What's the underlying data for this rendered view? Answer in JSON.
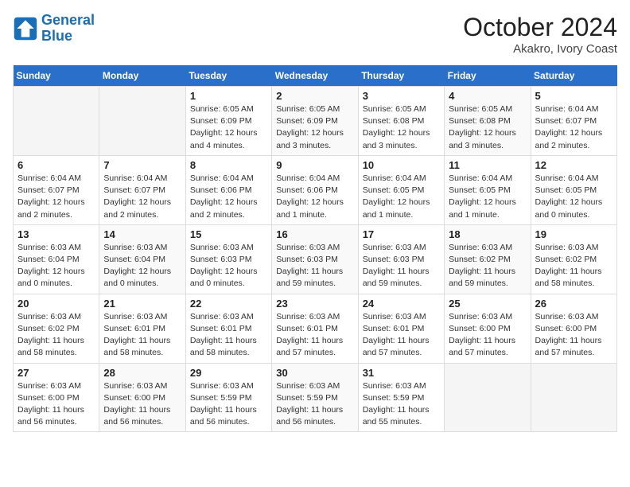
{
  "logo": {
    "line1": "General",
    "line2": "Blue"
  },
  "title": "October 2024",
  "subtitle": "Akakro, Ivory Coast",
  "days_of_week": [
    "Sunday",
    "Monday",
    "Tuesday",
    "Wednesday",
    "Thursday",
    "Friday",
    "Saturday"
  ],
  "weeks": [
    [
      {
        "num": "",
        "info": ""
      },
      {
        "num": "",
        "info": ""
      },
      {
        "num": "1",
        "info": "Sunrise: 6:05 AM\nSunset: 6:09 PM\nDaylight: 12 hours and 4 minutes."
      },
      {
        "num": "2",
        "info": "Sunrise: 6:05 AM\nSunset: 6:09 PM\nDaylight: 12 hours and 3 minutes."
      },
      {
        "num": "3",
        "info": "Sunrise: 6:05 AM\nSunset: 6:08 PM\nDaylight: 12 hours and 3 minutes."
      },
      {
        "num": "4",
        "info": "Sunrise: 6:05 AM\nSunset: 6:08 PM\nDaylight: 12 hours and 3 minutes."
      },
      {
        "num": "5",
        "info": "Sunrise: 6:04 AM\nSunset: 6:07 PM\nDaylight: 12 hours and 2 minutes."
      }
    ],
    [
      {
        "num": "6",
        "info": "Sunrise: 6:04 AM\nSunset: 6:07 PM\nDaylight: 12 hours and 2 minutes."
      },
      {
        "num": "7",
        "info": "Sunrise: 6:04 AM\nSunset: 6:07 PM\nDaylight: 12 hours and 2 minutes."
      },
      {
        "num": "8",
        "info": "Sunrise: 6:04 AM\nSunset: 6:06 PM\nDaylight: 12 hours and 2 minutes."
      },
      {
        "num": "9",
        "info": "Sunrise: 6:04 AM\nSunset: 6:06 PM\nDaylight: 12 hours and 1 minute."
      },
      {
        "num": "10",
        "info": "Sunrise: 6:04 AM\nSunset: 6:05 PM\nDaylight: 12 hours and 1 minute."
      },
      {
        "num": "11",
        "info": "Sunrise: 6:04 AM\nSunset: 6:05 PM\nDaylight: 12 hours and 1 minute."
      },
      {
        "num": "12",
        "info": "Sunrise: 6:04 AM\nSunset: 6:05 PM\nDaylight: 12 hours and 0 minutes."
      }
    ],
    [
      {
        "num": "13",
        "info": "Sunrise: 6:03 AM\nSunset: 6:04 PM\nDaylight: 12 hours and 0 minutes."
      },
      {
        "num": "14",
        "info": "Sunrise: 6:03 AM\nSunset: 6:04 PM\nDaylight: 12 hours and 0 minutes."
      },
      {
        "num": "15",
        "info": "Sunrise: 6:03 AM\nSunset: 6:03 PM\nDaylight: 12 hours and 0 minutes."
      },
      {
        "num": "16",
        "info": "Sunrise: 6:03 AM\nSunset: 6:03 PM\nDaylight: 11 hours and 59 minutes."
      },
      {
        "num": "17",
        "info": "Sunrise: 6:03 AM\nSunset: 6:03 PM\nDaylight: 11 hours and 59 minutes."
      },
      {
        "num": "18",
        "info": "Sunrise: 6:03 AM\nSunset: 6:02 PM\nDaylight: 11 hours and 59 minutes."
      },
      {
        "num": "19",
        "info": "Sunrise: 6:03 AM\nSunset: 6:02 PM\nDaylight: 11 hours and 58 minutes."
      }
    ],
    [
      {
        "num": "20",
        "info": "Sunrise: 6:03 AM\nSunset: 6:02 PM\nDaylight: 11 hours and 58 minutes."
      },
      {
        "num": "21",
        "info": "Sunrise: 6:03 AM\nSunset: 6:01 PM\nDaylight: 11 hours and 58 minutes."
      },
      {
        "num": "22",
        "info": "Sunrise: 6:03 AM\nSunset: 6:01 PM\nDaylight: 11 hours and 58 minutes."
      },
      {
        "num": "23",
        "info": "Sunrise: 6:03 AM\nSunset: 6:01 PM\nDaylight: 11 hours and 57 minutes."
      },
      {
        "num": "24",
        "info": "Sunrise: 6:03 AM\nSunset: 6:01 PM\nDaylight: 11 hours and 57 minutes."
      },
      {
        "num": "25",
        "info": "Sunrise: 6:03 AM\nSunset: 6:00 PM\nDaylight: 11 hours and 57 minutes."
      },
      {
        "num": "26",
        "info": "Sunrise: 6:03 AM\nSunset: 6:00 PM\nDaylight: 11 hours and 57 minutes."
      }
    ],
    [
      {
        "num": "27",
        "info": "Sunrise: 6:03 AM\nSunset: 6:00 PM\nDaylight: 11 hours and 56 minutes."
      },
      {
        "num": "28",
        "info": "Sunrise: 6:03 AM\nSunset: 6:00 PM\nDaylight: 11 hours and 56 minutes."
      },
      {
        "num": "29",
        "info": "Sunrise: 6:03 AM\nSunset: 5:59 PM\nDaylight: 11 hours and 56 minutes."
      },
      {
        "num": "30",
        "info": "Sunrise: 6:03 AM\nSunset: 5:59 PM\nDaylight: 11 hours and 56 minutes."
      },
      {
        "num": "31",
        "info": "Sunrise: 6:03 AM\nSunset: 5:59 PM\nDaylight: 11 hours and 55 minutes."
      },
      {
        "num": "",
        "info": ""
      },
      {
        "num": "",
        "info": ""
      }
    ]
  ]
}
